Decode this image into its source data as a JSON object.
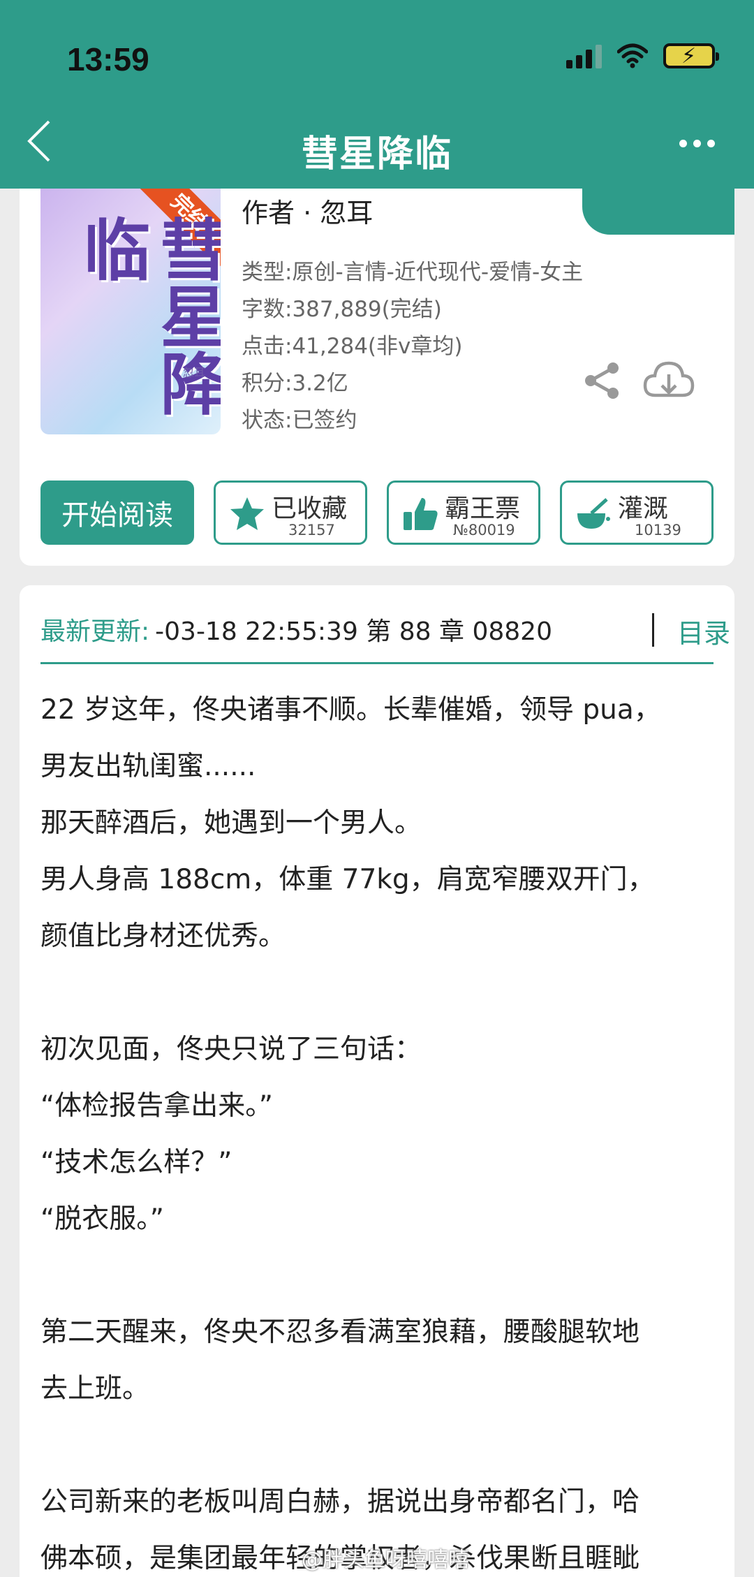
{
  "status_bar": {
    "time": "13:59"
  },
  "header": {
    "title": "彗星降临"
  },
  "cover": {
    "title": "彗星降临",
    "ribbon": "完结"
  },
  "book": {
    "author": "作者 · 忽耳",
    "meta": [
      "类型:原创-言情-近代现代-爱情-女主",
      "字数:387,889(完结)",
      "点击:41,284(非v章均)",
      "积分:3.2亿",
      "状态:已签约"
    ]
  },
  "actions": {
    "read_label": "开始阅读",
    "favorite_label": "已收藏",
    "favorite_count": "32157",
    "vote_label": "霸王票",
    "vote_count": "№80019",
    "water_label": "灌溉",
    "water_count": "10139"
  },
  "update": {
    "label": "最新更新:",
    "text": "-03-18 22:55:39   第 88 章 08820",
    "toc_label": "目录"
  },
  "synopsis": [
    "22 岁这年，佟央诸事不顺。长辈催婚，领导 pua，",
    "男友出轨闺蜜......",
    "那天醉酒后，她遇到一个男人。",
    "男人身高 188cm，体重 77kg，肩宽窄腰双开门，",
    "颜值比身材还优秀。",
    "",
    "初次见面，佟央只说了三句话：",
    "“体检报告拿出来。”",
    "“技术怎么样？”",
    "“脱衣服。”",
    "",
    "第二天醒来，佟央不忍多看满室狼藉，腰酸腿软地",
    "去上班。",
    "",
    "公司新来的老板叫周白赫，据说出身帝都名门，哈",
    "佛本硕，是集团最年轻的掌权者，杀伐果断且睚眦"
  ],
  "watermark": "@胖头鱼呀嘻嘻嘻",
  "colors": {
    "accent": "#2e9c8a",
    "ribbon": "#e65221"
  }
}
